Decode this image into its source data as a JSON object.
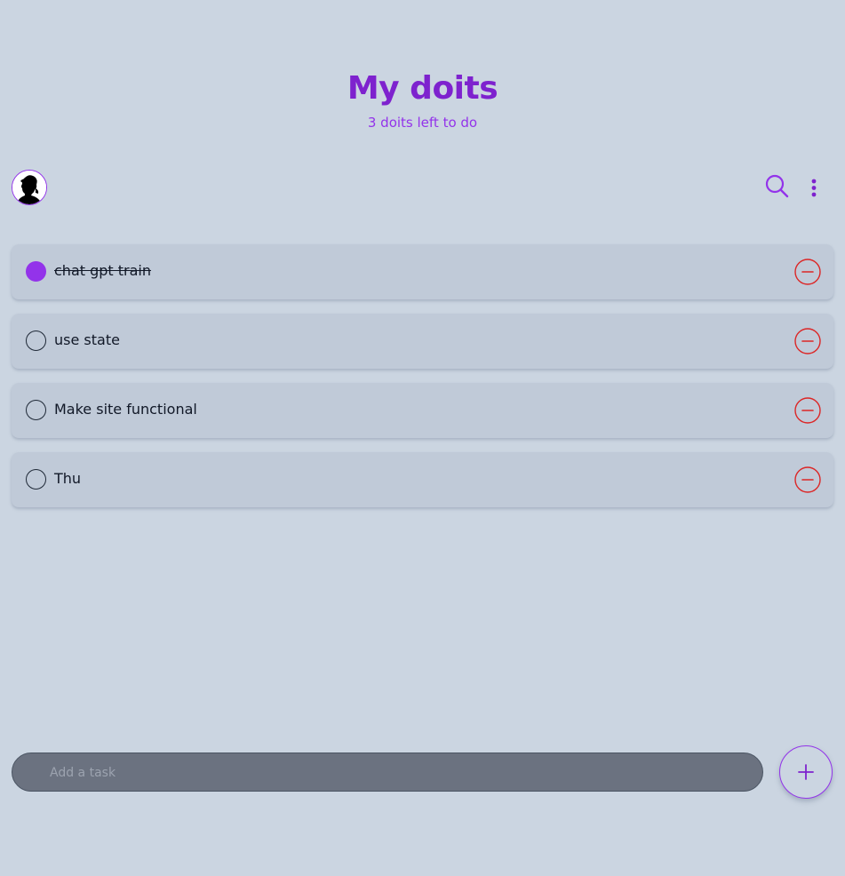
{
  "header": {
    "title": "My doits",
    "subtitle": "3 doits left to do"
  },
  "toolbar": {
    "avatar_icon": "user-avatar",
    "search_icon": "search-icon",
    "menu_icon": "more-vertical-icon"
  },
  "tasks": [
    {
      "label": "chat gpt train",
      "done": true
    },
    {
      "label": "use state",
      "done": false
    },
    {
      "label": "Make site functional",
      "done": false
    },
    {
      "label": "Thu",
      "done": false
    }
  ],
  "composer": {
    "placeholder": "Add a task",
    "value": "",
    "add_icon": "plus-icon"
  },
  "colors": {
    "background": "#cbd5e1",
    "accent": "#9333ea",
    "title": "#7e22ce",
    "task_bg": "#c0cad8",
    "remove": "#dc2626",
    "input_bg": "#6b7280"
  }
}
